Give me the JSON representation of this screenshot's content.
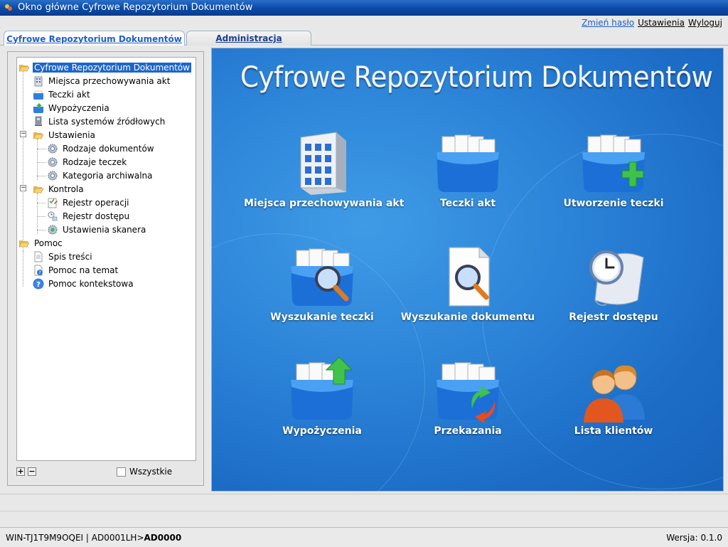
{
  "window": {
    "title": "Okno główne Cyfrowe Repozytorium Dokumentów"
  },
  "toplinks": {
    "change_password": "Zmień hasło",
    "settings": "Ustawienia",
    "logout": "Wyloguj"
  },
  "tabs": [
    {
      "label": "Cyfrowe Repozytorium Dokumentów",
      "active": true
    },
    {
      "label": "Administracja",
      "active": false
    }
  ],
  "tree": {
    "root": "Cyfrowe Repozytorium Dokumentów",
    "items": [
      {
        "label": "Miejsca przechowywania akt",
        "icon": "building-icon"
      },
      {
        "label": "Teczki akt",
        "icon": "folder-box-icon"
      },
      {
        "label": "Wypożyczenia",
        "icon": "loan-icon"
      },
      {
        "label": "Lista systemów źródłowych",
        "icon": "computer-icon"
      },
      {
        "label": "Ustawienia",
        "icon": "open-folder-icon"
      },
      {
        "label": "Rodzaje dokumentów",
        "icon": "gear-icon"
      },
      {
        "label": "Rodzaje teczek",
        "icon": "gear-icon"
      },
      {
        "label": "Kategoria archiwalna",
        "icon": "gear-icon"
      },
      {
        "label": "Kontrola",
        "icon": "open-folder-icon"
      },
      {
        "label": "Rejestr operacji",
        "icon": "checklist-icon"
      },
      {
        "label": "Rejestr dostępu",
        "icon": "access-icon"
      },
      {
        "label": "Ustawienia skanera",
        "icon": "scanner-settings-icon"
      },
      {
        "label": "Pomoc",
        "icon": "open-folder-icon"
      },
      {
        "label": "Spis treści",
        "icon": "document-icon"
      },
      {
        "label": "Pomoc na temat",
        "icon": "help-doc-icon"
      },
      {
        "label": "Pomoc kontekstowa",
        "icon": "help-icon"
      }
    ],
    "all_checkbox_label": "Wszystkie"
  },
  "main": {
    "hero_title": "Cyfrowe Repozytorium Dokumentów",
    "tiles": [
      {
        "label": "Miejsca przechowywania akt",
        "icon": "building-icon"
      },
      {
        "label": "Teczki akt",
        "icon": "folder-box-icon"
      },
      {
        "label": "Utworzenie teczki",
        "icon": "folder-add-icon"
      },
      {
        "label": "Wyszukanie teczki",
        "icon": "folder-search-icon"
      },
      {
        "label": "Wyszukanie dokumentu",
        "icon": "document-search-icon"
      },
      {
        "label": "Rejestr dostępu",
        "icon": "clock-scroll-icon"
      },
      {
        "label": "Wypożyczenia",
        "icon": "folder-upload-icon"
      },
      {
        "label": "Przekazania",
        "icon": "folder-transfer-icon"
      },
      {
        "label": "Lista klientów",
        "icon": "users-icon"
      }
    ]
  },
  "statusbar": {
    "machine": "WIN-TJ1T9M9OQEI | AD0001LH>",
    "user": "AD0000",
    "version": "Wersja: 0.1.0"
  },
  "colors": {
    "accent": "#1e66c9",
    "hero_bg": "#2c84d8",
    "title_bar": "#0b4aa6"
  }
}
